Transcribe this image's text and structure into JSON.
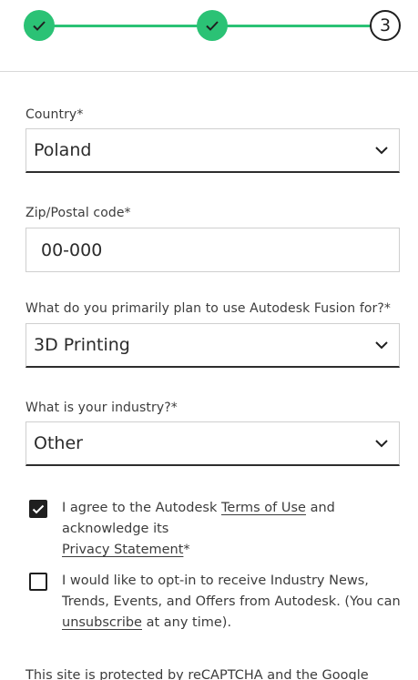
{
  "stepper": {
    "steps": [
      {
        "state": "done",
        "icon": "check-icon"
      },
      {
        "state": "done",
        "icon": "check-icon"
      },
      {
        "state": "current",
        "label": "3"
      }
    ],
    "colors": {
      "done": "#2bc275",
      "current_border": "#1f1f1f"
    }
  },
  "form": {
    "country": {
      "label": "Country*",
      "value": "Poland"
    },
    "zip": {
      "label": "Zip/Postal code*",
      "value": "00-000"
    },
    "use": {
      "label": "What do you primarily plan to use Autodesk Fusion for?*",
      "value": "3D Printing"
    },
    "industry": {
      "label": "What is your industry?*",
      "value": "Other"
    },
    "terms": {
      "checked": true,
      "text_before": "I agree to the Autodesk ",
      "terms_link": "Terms of Use",
      "text_middle": " and acknowledge its ",
      "privacy_link": "Privacy Statement",
      "text_after": "*"
    },
    "optin": {
      "checked": false,
      "text_before": "I would like to opt-in to receive Industry News, Trends, Events, and Offers from Autodesk. (You can ",
      "unsubscribe_link": "unsubscribe",
      "text_after": " at any time)."
    }
  },
  "footer": {
    "text": "This site is protected by reCAPTCHA and the Google"
  }
}
